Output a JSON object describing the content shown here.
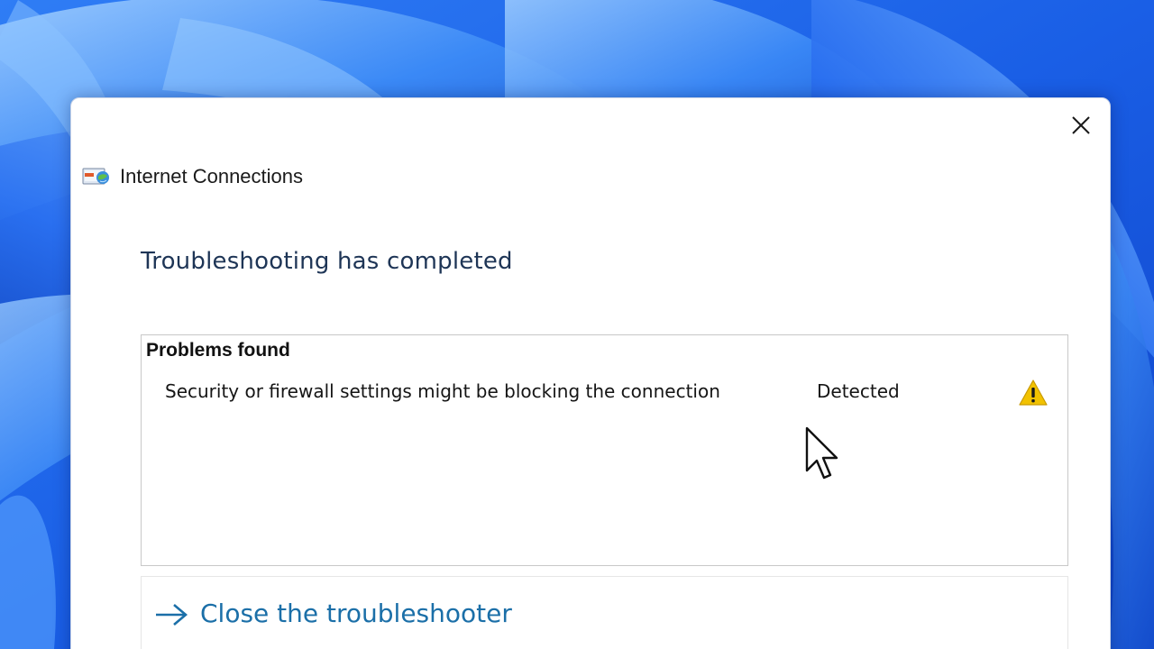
{
  "window": {
    "title": "Internet Connections",
    "close_label": "Close"
  },
  "main": {
    "heading": "Troubleshooting has completed",
    "problems": {
      "header": "Problems found",
      "items": [
        {
          "description": "Security or firewall settings might be blocking the connection",
          "status": "Detected",
          "status_icon": "warning-icon"
        }
      ]
    },
    "actions": {
      "close_troubleshooter": "Close the troubleshooter",
      "close_icon": "arrow-right-icon"
    }
  },
  "colors": {
    "accent_link": "#1b6fa8",
    "heading": "#1e3556",
    "warning": "#f2c200",
    "wallpaper": "#1f63e8"
  }
}
